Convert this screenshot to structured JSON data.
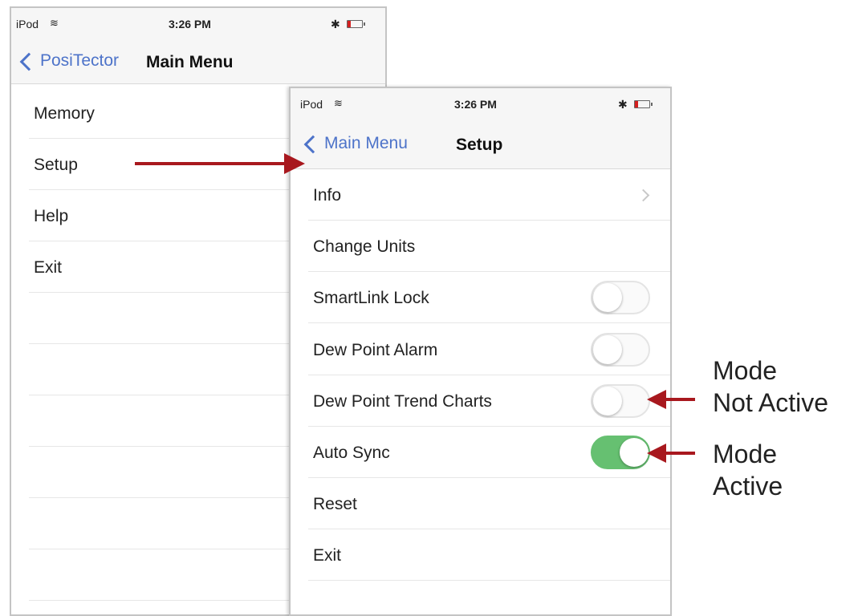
{
  "main_screen": {
    "status": {
      "carrier": "iPod",
      "time": "3:26 PM",
      "bluetooth": "✱"
    },
    "nav": {
      "back_label": "PosiTector",
      "title": "Main Menu"
    },
    "items": [
      {
        "label": "Memory"
      },
      {
        "label": "Setup"
      },
      {
        "label": "Help"
      },
      {
        "label": "Exit"
      }
    ]
  },
  "setup_screen": {
    "status": {
      "carrier": "iPod",
      "time": "3:26 PM",
      "bluetooth": "✱"
    },
    "nav": {
      "back_label": "Main Menu",
      "title": "Setup"
    },
    "items": [
      {
        "label": "Info",
        "control": "disclosure"
      },
      {
        "label": "Change Units",
        "control": "none"
      },
      {
        "label": "SmartLink Lock",
        "control": "toggle",
        "on": false
      },
      {
        "label": "Dew Point Alarm",
        "control": "toggle",
        "on": false
      },
      {
        "label": "Dew Point Trend Charts",
        "control": "toggle",
        "on": false
      },
      {
        "label": "Auto Sync",
        "control": "toggle",
        "on": true
      },
      {
        "label": "Reset",
        "control": "none"
      },
      {
        "label": "Exit",
        "control": "none"
      }
    ]
  },
  "annotations": {
    "not_active": {
      "line1": "Mode",
      "line2": "Not Active"
    },
    "active": {
      "line1": "Mode",
      "line2": "Active"
    }
  },
  "colors": {
    "arrow": "#a8181e",
    "toggle_on": "#66c071",
    "link": "#4d73c9"
  }
}
